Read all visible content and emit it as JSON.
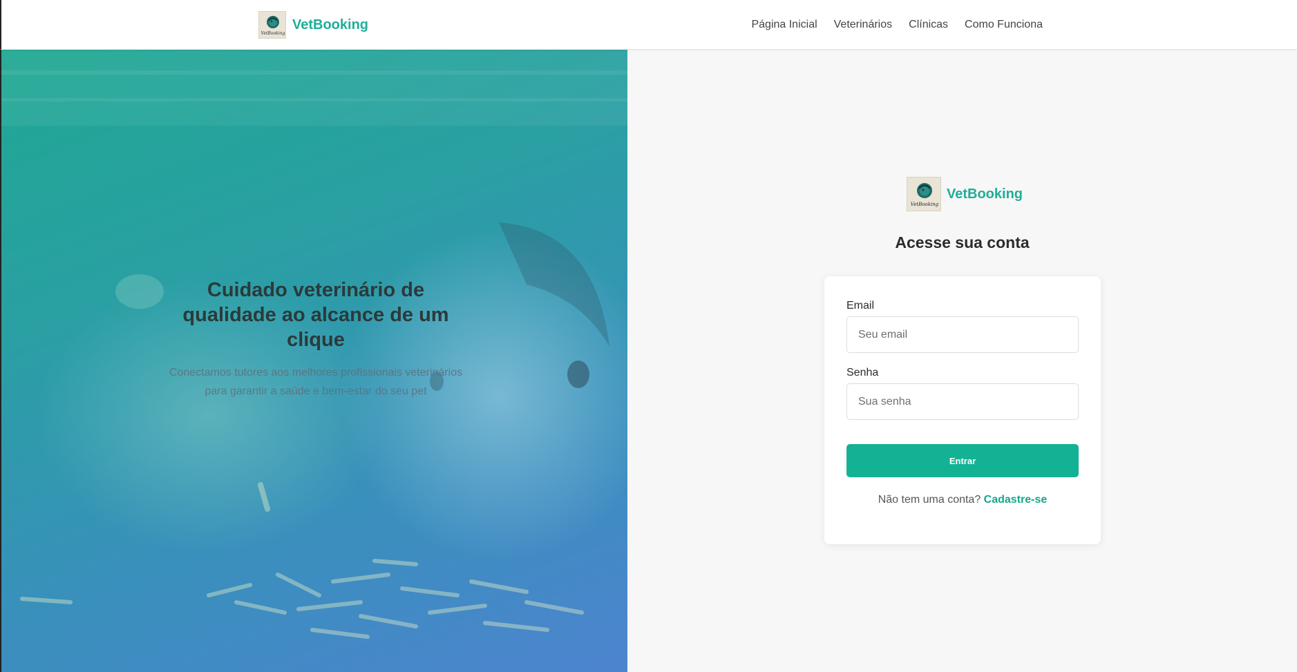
{
  "header": {
    "brand": "VetBooking",
    "logo_text": "VetBooking",
    "nav": [
      {
        "label": "Página Inicial"
      },
      {
        "label": "Veterinários"
      },
      {
        "label": "Clínicas"
      },
      {
        "label": "Como Funciona"
      }
    ]
  },
  "hero": {
    "title": "Cuidado veterinário de qualidade ao alcance de um clique",
    "subtitle": "Conectamos tutores aos melhores profissionais veterinários para garantir a saúde e bem-estar do seu pet"
  },
  "login": {
    "brand": "VetBooking",
    "logo_text": "VetBooking",
    "title": "Acesse sua conta",
    "email_label": "Email",
    "email_placeholder": "Seu email",
    "email_value": "",
    "password_label": "Senha",
    "password_placeholder": "Sua senha",
    "password_value": "",
    "submit_label": "Entrar",
    "signup_prompt": "Não tem uma conta?",
    "signup_link": "Cadastre-se"
  },
  "colors": {
    "brand": "#1fae97",
    "button": "#14b294",
    "panel_bg": "#f7f7f7"
  }
}
